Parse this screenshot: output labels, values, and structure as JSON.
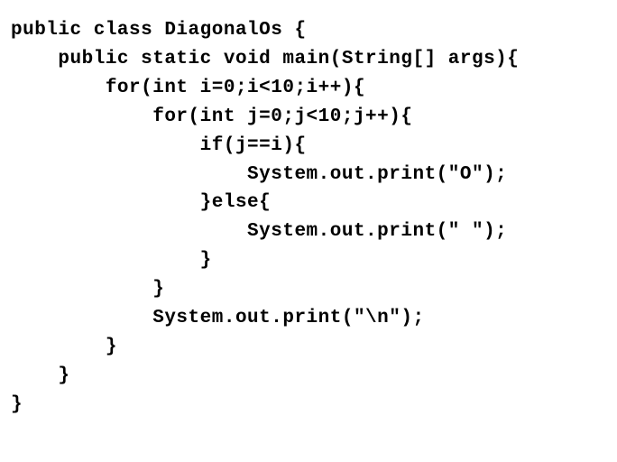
{
  "code": {
    "lines": [
      "public class DiagonalOs {",
      "    public static void main(String[] args){",
      "        for(int i=0;i<10;i++){",
      "            for(int j=0;j<10;j++){",
      "                if(j==i){",
      "                    System.out.print(\"O\");",
      "                }else{",
      "                    System.out.print(\" \");",
      "                }",
      "            }",
      "            System.out.print(\"\\n\");",
      "        }",
      "    }",
      "}"
    ]
  }
}
